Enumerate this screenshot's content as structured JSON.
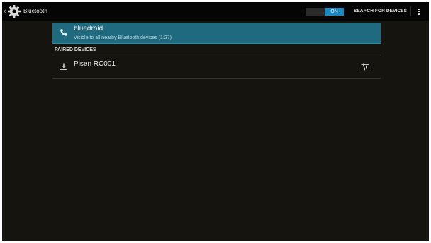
{
  "actionbar": {
    "title": "Bluetooth",
    "toggle_label": "ON",
    "search_label": "SEARCH FOR DEVICES",
    "up_glyph": "‹",
    "icons": {
      "app": "settings-gear-icon",
      "overflow": "overflow-menu-icon"
    }
  },
  "device": {
    "name": "bluedroid",
    "subtitle": "Visible to all nearby Bluetooth devices (1:27)",
    "icon": "phone-icon",
    "highlight_color": "#1f6a7e"
  },
  "paired": {
    "header": "PAIRED DEVICES",
    "items": [
      {
        "name": "Pisen RC001",
        "icon": "keyboard-icon",
        "settings_icon": "device-settings-icon"
      }
    ]
  },
  "colors": {
    "toggle_on": "#1b88c0",
    "background": "#16140f",
    "actionbar": "#050505"
  }
}
